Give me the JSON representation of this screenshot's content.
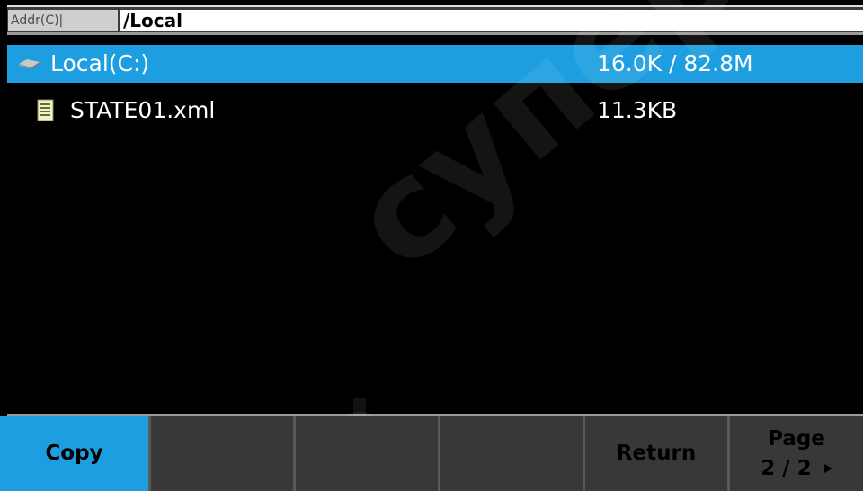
{
  "address_bar": {
    "label": "Addr(C)|",
    "path": "/Local"
  },
  "file_list": [
    {
      "name": "Local(C:)",
      "size": "16.0K / 82.8M",
      "icon": "drive-icon",
      "selected": true
    },
    {
      "name": "STATE01.xml",
      "size": "11.3KB",
      "icon": "document-icon",
      "selected": false
    }
  ],
  "softkeys": [
    {
      "label": "Copy",
      "active": true
    },
    {
      "label": "",
      "active": false
    },
    {
      "label": "",
      "active": false
    },
    {
      "label": "",
      "active": false
    },
    {
      "label": "Return",
      "active": false
    },
    {
      "label": "Page",
      "page_indicator": "2 / 2",
      "active": false
    }
  ],
  "watermark": "супераис",
  "colors": {
    "selection": "#1c9ee0",
    "background": "#000000",
    "softkey_bg": "#383838",
    "address_bg": "#ffffff"
  }
}
